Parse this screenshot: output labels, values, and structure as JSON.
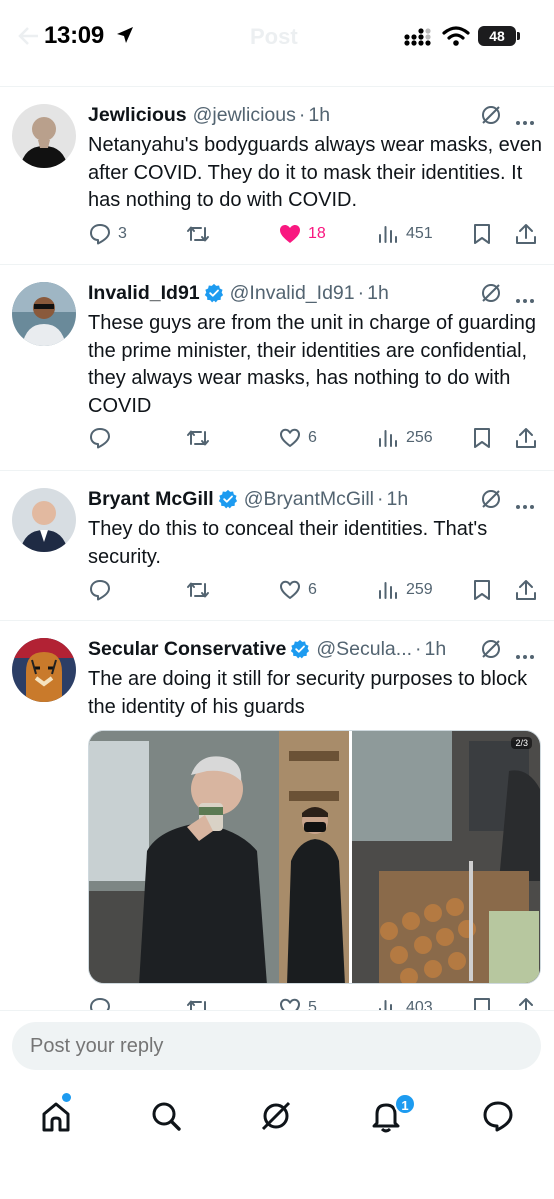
{
  "status_bar": {
    "time": "13:09",
    "faded_title": "Post",
    "battery": "48"
  },
  "tweets": [
    {
      "name": "Jewlicious",
      "verified": false,
      "handle": "@jewlicious",
      "time": "1h",
      "text": "Netanyahu's bodyguards always wear masks, even after COVID. They do it to mask their identities. It has nothing to do with COVID.",
      "replies": "3",
      "reposts": "",
      "likes": "18",
      "liked": true,
      "views": "451"
    },
    {
      "name": "Invalid_Id91",
      "verified": true,
      "handle": "@Invalid_Id91",
      "time": "1h",
      "text": "These guys are from the unit in charge of guarding the prime minister, their identities are confidential, they always wear masks, has nothing to do with COVID",
      "replies": "",
      "reposts": "",
      "likes": "6",
      "liked": false,
      "views": "256"
    },
    {
      "name": "Bryant McGill",
      "verified": true,
      "handle": "@BryantMcGill",
      "time": "1h",
      "text": "They do this to conceal their identities. That's security.",
      "replies": "",
      "reposts": "",
      "likes": "6",
      "liked": false,
      "views": "259"
    },
    {
      "name": "Secular Conservative",
      "verified": true,
      "handle": "@Secula...",
      "time": "1h",
      "text": "The are doing it still for security purposes to block the identity of his guards",
      "media_counter": "2/3",
      "replies": "",
      "reposts": "",
      "likes": "5",
      "liked": false,
      "views": "403"
    }
  ],
  "reply_bar": {
    "placeholder": "Post your reply"
  },
  "tabbar": {
    "notification_count": "1",
    "items": [
      "home-icon",
      "search-icon",
      "grok-icon",
      "notifications-icon",
      "messages-icon"
    ]
  },
  "colors": {
    "accent": "#1d9bf0",
    "like": "#f91880",
    "secondary_text": "#536471",
    "divider": "#eff3f4"
  }
}
